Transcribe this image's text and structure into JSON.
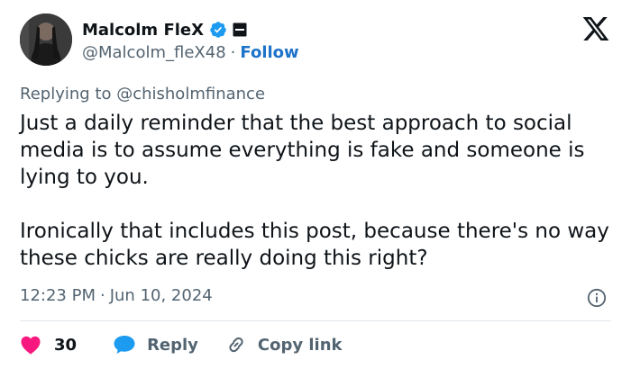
{
  "author": {
    "display_name": "Malcolm FleX",
    "handle": "@Malcolm_fleX48",
    "separator": "·",
    "follow_label": "Follow",
    "verified_color": "#1d9bf0"
  },
  "tweet": {
    "replying_prefix": "Replying to",
    "replying_to": "@chisholmfinance",
    "paragraphs": [
      "Just a daily reminder that the best approach to social media is to assume everything is fake and someone is lying to you.",
      "Ironically that includes this post, because there's no way these chicks are really doing this right?"
    ],
    "time": "12:23 PM",
    "date_separator": "·",
    "date": "Jun 10, 2024"
  },
  "actions": {
    "like_count": "30",
    "reply_label": "Reply",
    "copy_label": "Copy link",
    "like_color": "#f91880",
    "reply_color": "#1d9bf0"
  },
  "icons": {
    "brand": "x-logo-icon",
    "info": "info-icon",
    "like": "heart-icon",
    "reply": "speech-bubble-icon",
    "copy": "link-icon"
  }
}
